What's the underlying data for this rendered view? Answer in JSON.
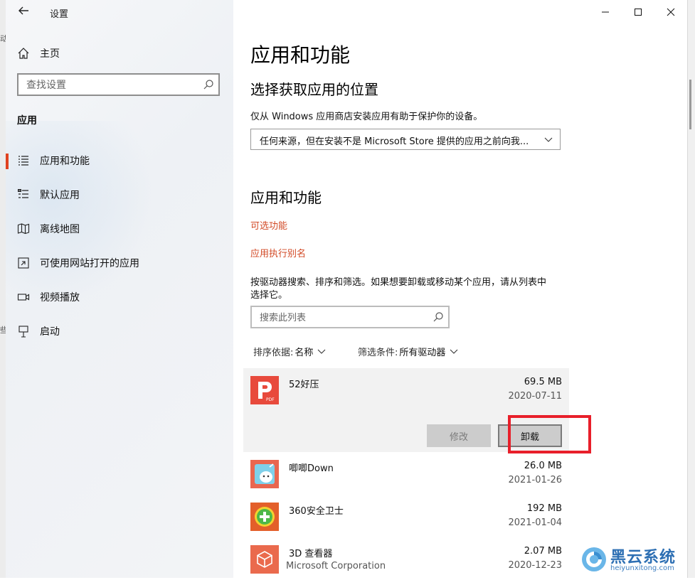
{
  "window": {
    "title": "设置"
  },
  "sidebar": {
    "home_label": "主页",
    "search_placeholder": "查找设置",
    "section_label": "应用",
    "items": [
      {
        "label": "应用和功能",
        "icon": "list-icon",
        "active": true
      },
      {
        "label": "默认应用",
        "icon": "default-apps-icon",
        "active": false
      },
      {
        "label": "离线地图",
        "icon": "map-icon",
        "active": false
      },
      {
        "label": "可使用网站打开的应用",
        "icon": "web-apps-icon",
        "active": false
      },
      {
        "label": "视频播放",
        "icon": "video-icon",
        "active": false
      },
      {
        "label": "启动",
        "icon": "startup-icon",
        "active": false
      }
    ]
  },
  "main": {
    "title": "应用和功能",
    "install_section": {
      "heading": "选择获取应用的位置",
      "description": "仅从 Windows 应用商店安装应用有助于保护你的设备。",
      "dropdown_value": "任何来源，但在安装不是 Microsoft Store 提供的应用之前向我..."
    },
    "apps_section": {
      "heading": "应用和功能",
      "optional_features_link": "可选功能",
      "app_alias_link": "应用执行别名",
      "description_line1": "按驱动器搜索、排序和筛选。如果想要卸载或移动某个应用，请从列表中",
      "description_line2": "选择它。",
      "search_placeholder": "搜索此列表",
      "sort_label": "排序依据:",
      "sort_value": "名称",
      "filter_label": "筛选条件:",
      "filter_value": "所有驱动器"
    },
    "apps": [
      {
        "name": "52好压",
        "publisher": "",
        "size": "69.5 MB",
        "date": "2020-07-11",
        "expanded": true,
        "icon_color": "#e84a3c"
      },
      {
        "name": "唧唧Down",
        "publisher": "",
        "size": "26.0 MB",
        "date": "2021-01-26",
        "expanded": false,
        "icon_color": "#e9664f"
      },
      {
        "name": "360安全卫士",
        "publisher": "",
        "size": "192 MB",
        "date": "2021-01-04",
        "expanded": false,
        "icon_color": "#e35f2a"
      },
      {
        "name": "3D 查看器",
        "publisher": "Microsoft Corporation",
        "size": "2.07 MB",
        "date": "2020-12-23",
        "expanded": false,
        "icon_color": "#ea6a4d"
      }
    ],
    "buttons": {
      "modify": "修改",
      "uninstall": "卸载"
    }
  },
  "watermark": {
    "title": "黑云系统",
    "url": "heiyunxitong.com"
  },
  "colors": {
    "accent": "#e0421f",
    "link": "#d24a26",
    "highlight": "#e81f2a"
  }
}
